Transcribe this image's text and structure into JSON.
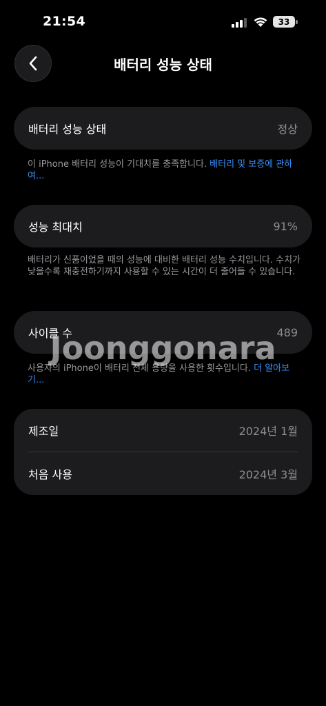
{
  "status_bar": {
    "time": "21:54",
    "battery_level": "33",
    "signal_icon": "cellular-signal-icon",
    "wifi_icon": "wifi-icon",
    "battery_icon": "battery-icon"
  },
  "nav": {
    "back_icon": "chevron-left-icon",
    "title": "배터리 성능 상태"
  },
  "health": {
    "label": "배터리 성능 상태",
    "value": "정상",
    "footnote": "이 iPhone 배터리 성능이 기대치를 충족합니다. ",
    "footnote_link": "배터리 및 보증에 관하여..."
  },
  "max_capacity": {
    "label": "성능 최대치",
    "value": "91%",
    "footnote": "배터리가 신품이었을 때의 성능에 대비한 배터리 성능 수치입니다. 수치가 낮을수록 재충전하기까지 사용할 수 있는 시간이 더 줄어들 수 있습니다."
  },
  "cycle_count": {
    "label": "사이클 수",
    "value": "489",
    "footnote": "사용자의 iPhone이 배터리 전체 용량을 사용한 횟수입니다. ",
    "footnote_link": "더 알아보기..."
  },
  "info": {
    "manufacture_label": "제조일",
    "manufacture_value": "2024년 1월",
    "first_use_label": "처음 사용",
    "first_use_value": "2024년 3월"
  },
  "watermark": "Joonggonara",
  "colors": {
    "background": "#000000",
    "card": "#1c1c1e",
    "link": "#3a8ffe",
    "secondary_text": "#8e8e93"
  }
}
